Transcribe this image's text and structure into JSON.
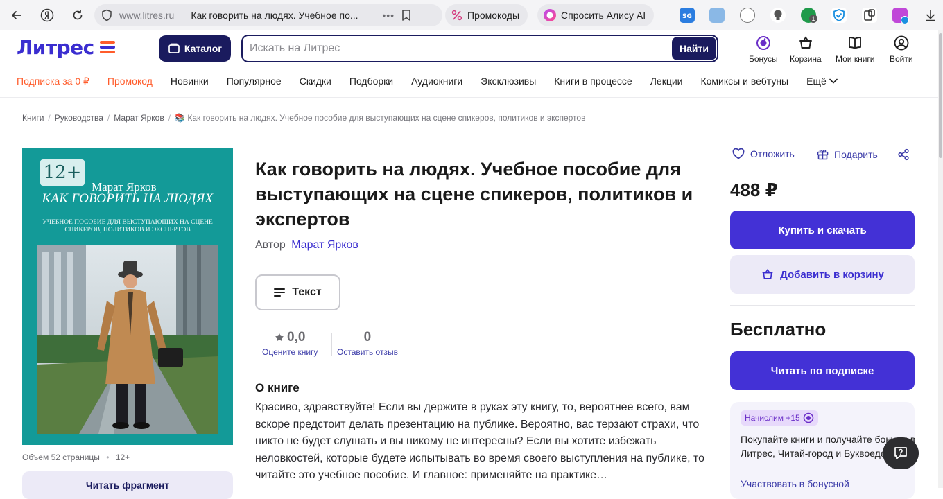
{
  "browser": {
    "url": "www.litres.ru",
    "tab_title": "Как говорить на людях. Учебное по...",
    "promo_pill": "Промокоды",
    "alice_pill": "Спросить Алису AI",
    "ext_badge_count": "1"
  },
  "header": {
    "logo_text": "Литрес",
    "catalog_label": "Каталог",
    "search": {
      "placeholder": "Искать на Литрес",
      "value": ""
    },
    "search_button": "Найти",
    "icons": [
      {
        "name": "bonus-icon",
        "label": "Бонусы"
      },
      {
        "name": "cart-icon",
        "label": "Корзина"
      },
      {
        "name": "my-books-icon",
        "label": "Мои книги"
      },
      {
        "name": "user-icon",
        "label": "Войти"
      }
    ]
  },
  "nav": {
    "items": [
      "Подписка за 0 ₽",
      "Промокод",
      "Новинки",
      "Популярное",
      "Скидки",
      "Подборки",
      "Аудиокниги",
      "Эксклюзивы",
      "Книги в процессе",
      "Лекции",
      "Комиксы и вебтуны",
      "Ещё"
    ]
  },
  "breadcrumbs": [
    "Книги",
    "Руководства",
    "Марат Ярков",
    "📚 Как говорить на людях. Учебное пособие для выступающих на сцене спикеров, политиков и экспертов"
  ],
  "cover": {
    "age": "12+",
    "author": "Марат Ярков",
    "title": "КАК ГОВОРИТЬ НА ЛЮДЯХ",
    "subtitle": "УЧЕБНОЕ ПОСОБИЕ ДЛЯ ВЫСТУПАЮЩИХ НА СЦЕНЕ СПИКЕРОВ, ПОЛИТИКОВ И ЭКСПЕРТОВ"
  },
  "book": {
    "volume": "Объем 52 страницы",
    "age": "12+",
    "fragment_button": "Читать фрагмент",
    "title": "Как говорить на людях. Учебное пособие для выступающих на сцене спикеров, политиков и экспертов",
    "author_label": "Автор",
    "author": "Марат Ярков",
    "format_label": "Текст",
    "rating_value": "0,0",
    "rating_action": "Оцените книгу",
    "reviews_count": "0",
    "reviews_action": "Оставить отзыв",
    "about_heading": "О книге",
    "about_text": "Красиво, здравствуйте! Если вы держите в руках эту книгу, то, вероятнее всего, вам вскоре предстоит делать презентацию на публике. Вероятно, вас терзают страхи, что никто не будет слушать и вы никому не интересны? Если вы хотите избежать неловкостей, которые будете испытывать во время своего выступления на публике, то читайте это учебное пособие. И главное: применяйте на практике…"
  },
  "sidebar": {
    "defer_label": "Отложить",
    "gift_label": "Подарить",
    "price": "488 ₽",
    "buy_label": "Купить и скачать",
    "cart_label": "Добавить в корзину",
    "free_heading": "Бесплатно",
    "subscription_label": "Читать по подписке",
    "bonus_badge": "Начислим +15",
    "bonus_text": "Покупайте книги и получайте бонусы в Литрес, Читай-город и Буквоеде.",
    "bonus_link": "Участвовать в бонусной"
  },
  "colors": {
    "brand": "#3b2ed0",
    "navy": "#1a1b5e",
    "primary_button": "#4331d6",
    "accent_orange": "#ff5c2b",
    "cover_teal": "#139a98"
  }
}
